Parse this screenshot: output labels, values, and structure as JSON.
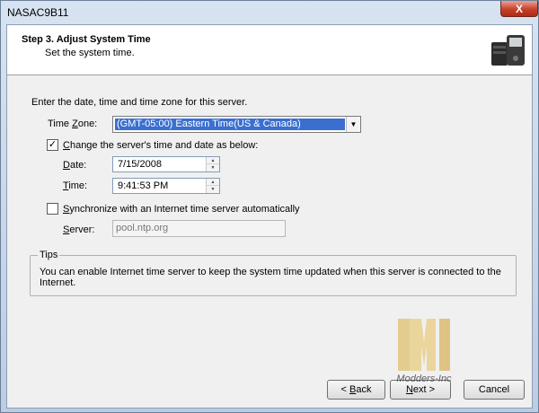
{
  "window": {
    "title": "NASAC9B11",
    "close_label": "X"
  },
  "header": {
    "title": "Step 3. Adjust System Time",
    "subtitle": "Set the system time."
  },
  "intro": "Enter the date, time and time zone for this server.",
  "timezone": {
    "label_pre": "Time ",
    "label_key": "Z",
    "label_post": "one:",
    "value": "(GMT-05:00) Eastern Time(US & Canada)"
  },
  "change_datetime": {
    "checked": true,
    "label_key": "C",
    "label_post": "hange the server's time and date as below:",
    "date": {
      "label_key": "D",
      "label_post": "ate:",
      "value": "7/15/2008"
    },
    "time": {
      "label_key": "T",
      "label_post": "ime:",
      "value": "9:41:53 PM"
    }
  },
  "sync": {
    "checked": false,
    "label_key": "S",
    "label_post": "ynchronize with an Internet time server automatically",
    "server": {
      "label_key": "S",
      "label_post": "erver:",
      "placeholder": "pool.ntp.org"
    }
  },
  "tips": {
    "legend": "Tips",
    "text": "You can enable Internet time server to keep the system time updated when this server is connected to the Internet."
  },
  "buttons": {
    "back_prefix": "< ",
    "back_key": "B",
    "back_post": "ack",
    "next_key": "N",
    "next_post": "ext >",
    "cancel": "Cancel"
  },
  "watermark": {
    "text": "Modders-Inc"
  },
  "colors": {
    "selection": "#3b6fcf",
    "close": "#c7412a"
  }
}
